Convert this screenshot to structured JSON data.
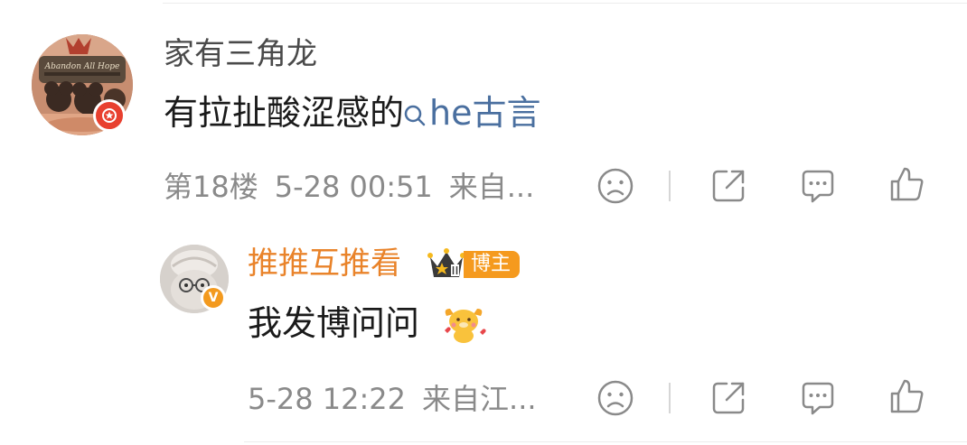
{
  "comment": {
    "username": "家有三角龙",
    "text": "有拉扯酸涩感的",
    "search_link": "he古言",
    "floor": "第18楼",
    "timestamp": "5-28 00:51",
    "source": "来自...",
    "avatar_text": "Abandon All Hope"
  },
  "reply": {
    "username": "推推互推看",
    "badge": "博主",
    "text": "我发博问问",
    "timestamp": "5-28 12:22",
    "source": "来自江..."
  },
  "colors": {
    "link": "#4a6f9f",
    "reply_username": "#e9832a",
    "badge_orange": "#f59a1e",
    "red_badge": "#e8402f",
    "meta_gray": "#8a8a8a"
  },
  "icons": {
    "dislike": "sad-face-icon",
    "share": "share-icon",
    "comment": "comment-icon",
    "like": "thumbs-up-icon"
  }
}
